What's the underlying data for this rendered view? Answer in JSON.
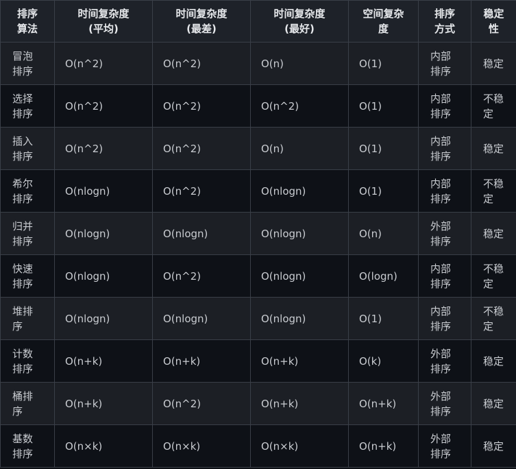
{
  "table": {
    "headers": [
      "排序算法",
      "时间复杂度(平均)",
      "时间复杂度(最差)",
      "时间复杂度(最好)",
      "空间复杂度",
      "排序方式",
      "稳定性"
    ],
    "header_lines": [
      [
        "排序",
        "算法"
      ],
      [
        "时间复杂度",
        "(平均)"
      ],
      [
        "时间复杂度",
        "(最差)"
      ],
      [
        "时间复杂度",
        "(最好)"
      ],
      [
        "空间复杂",
        "度"
      ],
      [
        "排序",
        "方式"
      ],
      [
        "稳定",
        "性"
      ]
    ],
    "rows": [
      {
        "name": [
          "冒泡",
          "排序"
        ],
        "avg": "O(n^2)",
        "worst": "O(n^2)",
        "best": "O(n)",
        "space": "O(1)",
        "mode": [
          "内部",
          "排序"
        ],
        "stable": [
          "稳定"
        ]
      },
      {
        "name": [
          "选择",
          "排序"
        ],
        "avg": "O(n^2)",
        "worst": "O(n^2)",
        "best": "O(n^2)",
        "space": "O(1)",
        "mode": [
          "内部",
          "排序"
        ],
        "stable": [
          "不稳",
          "定"
        ]
      },
      {
        "name": [
          "插入",
          "排序"
        ],
        "avg": "O(n^2)",
        "worst": "O(n^2)",
        "best": "O(n)",
        "space": "O(1)",
        "mode": [
          "内部",
          "排序"
        ],
        "stable": [
          "稳定"
        ]
      },
      {
        "name": [
          "希尔",
          "排序"
        ],
        "avg": "O(nlogn)",
        "worst": "O(n^2)",
        "best": "O(nlogn)",
        "space": "O(1)",
        "mode": [
          "内部",
          "排序"
        ],
        "stable": [
          "不稳",
          "定"
        ]
      },
      {
        "name": [
          "归并",
          "排序"
        ],
        "avg": "O(nlogn)",
        "worst": "O(nlogn)",
        "best": "O(nlogn)",
        "space": "O(n)",
        "mode": [
          "外部",
          "排序"
        ],
        "stable": [
          "稳定"
        ]
      },
      {
        "name": [
          "快速",
          "排序"
        ],
        "avg": "O(nlogn)",
        "worst": "O(n^2)",
        "best": "O(nlogn)",
        "space": "O(logn)",
        "mode": [
          "内部",
          "排序"
        ],
        "stable": [
          "不稳",
          "定"
        ]
      },
      {
        "name": [
          "堆排",
          "序"
        ],
        "avg": "O(nlogn)",
        "worst": "O(nlogn)",
        "best": "O(nlogn)",
        "space": "O(1)",
        "mode": [
          "内部",
          "排序"
        ],
        "stable": [
          "不稳",
          "定"
        ]
      },
      {
        "name": [
          "计数",
          "排序"
        ],
        "avg": "O(n+k)",
        "worst": "O(n+k)",
        "best": "O(n+k)",
        "space": "O(k)",
        "mode": [
          "外部",
          "排序"
        ],
        "stable": [
          "稳定"
        ]
      },
      {
        "name": [
          "桶排",
          "序"
        ],
        "avg": "O(n+k)",
        "worst": "O(n^2)",
        "best": "O(n+k)",
        "space": "O(n+k)",
        "mode": [
          "外部",
          "排序"
        ],
        "stable": [
          "稳定"
        ]
      },
      {
        "name": [
          "基数",
          "排序"
        ],
        "avg": "O(n×k)",
        "worst": "O(n×k)",
        "best": "O(n×k)",
        "space": "O(n+k)",
        "mode": [
          "外部",
          "排序"
        ],
        "stable": [
          "稳定"
        ]
      }
    ]
  }
}
